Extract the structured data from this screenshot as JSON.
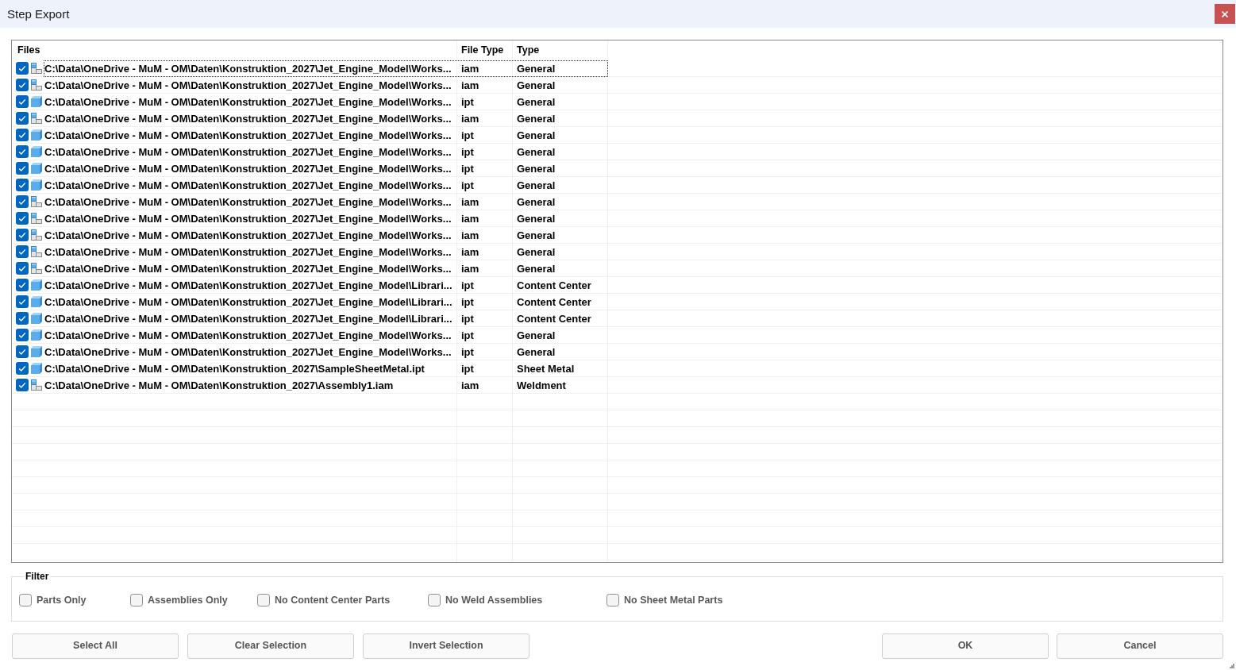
{
  "window": {
    "title": "Step Export"
  },
  "table": {
    "columns": [
      "Files",
      "File Type",
      "Type"
    ],
    "rows": [
      {
        "checked": true,
        "focused": true,
        "kind": "assembly",
        "path": "C:\\Data\\OneDrive - MuM - OM\\Daten\\Konstruktion_2027\\Jet_Engine_Model\\Works...",
        "file_type": "iam",
        "type": "General"
      },
      {
        "checked": true,
        "focused": false,
        "kind": "assembly",
        "path": "C:\\Data\\OneDrive - MuM - OM\\Daten\\Konstruktion_2027\\Jet_Engine_Model\\Works...",
        "file_type": "iam",
        "type": "General"
      },
      {
        "checked": true,
        "focused": false,
        "kind": "part",
        "path": "C:\\Data\\OneDrive - MuM - OM\\Daten\\Konstruktion_2027\\Jet_Engine_Model\\Works...",
        "file_type": "ipt",
        "type": "General"
      },
      {
        "checked": true,
        "focused": false,
        "kind": "assembly",
        "path": "C:\\Data\\OneDrive - MuM - OM\\Daten\\Konstruktion_2027\\Jet_Engine_Model\\Works...",
        "file_type": "iam",
        "type": "General"
      },
      {
        "checked": true,
        "focused": false,
        "kind": "part",
        "path": "C:\\Data\\OneDrive - MuM - OM\\Daten\\Konstruktion_2027\\Jet_Engine_Model\\Works...",
        "file_type": "ipt",
        "type": "General"
      },
      {
        "checked": true,
        "focused": false,
        "kind": "part",
        "path": "C:\\Data\\OneDrive - MuM - OM\\Daten\\Konstruktion_2027\\Jet_Engine_Model\\Works...",
        "file_type": "ipt",
        "type": "General"
      },
      {
        "checked": true,
        "focused": false,
        "kind": "part",
        "path": "C:\\Data\\OneDrive - MuM - OM\\Daten\\Konstruktion_2027\\Jet_Engine_Model\\Works...",
        "file_type": "ipt",
        "type": "General"
      },
      {
        "checked": true,
        "focused": false,
        "kind": "part",
        "path": "C:\\Data\\OneDrive - MuM - OM\\Daten\\Konstruktion_2027\\Jet_Engine_Model\\Works...",
        "file_type": "ipt",
        "type": "General"
      },
      {
        "checked": true,
        "focused": false,
        "kind": "assembly",
        "path": "C:\\Data\\OneDrive - MuM - OM\\Daten\\Konstruktion_2027\\Jet_Engine_Model\\Works...",
        "file_type": "iam",
        "type": "General"
      },
      {
        "checked": true,
        "focused": false,
        "kind": "assembly",
        "path": "C:\\Data\\OneDrive - MuM - OM\\Daten\\Konstruktion_2027\\Jet_Engine_Model\\Works...",
        "file_type": "iam",
        "type": "General"
      },
      {
        "checked": true,
        "focused": false,
        "kind": "assembly",
        "path": "C:\\Data\\OneDrive - MuM - OM\\Daten\\Konstruktion_2027\\Jet_Engine_Model\\Works...",
        "file_type": "iam",
        "type": "General"
      },
      {
        "checked": true,
        "focused": false,
        "kind": "assembly",
        "path": "C:\\Data\\OneDrive - MuM - OM\\Daten\\Konstruktion_2027\\Jet_Engine_Model\\Works...",
        "file_type": "iam",
        "type": "General"
      },
      {
        "checked": true,
        "focused": false,
        "kind": "assembly",
        "path": "C:\\Data\\OneDrive - MuM - OM\\Daten\\Konstruktion_2027\\Jet_Engine_Model\\Works...",
        "file_type": "iam",
        "type": "General"
      },
      {
        "checked": true,
        "focused": false,
        "kind": "part",
        "path": "C:\\Data\\OneDrive - MuM - OM\\Daten\\Konstruktion_2027\\Jet_Engine_Model\\Librari...",
        "file_type": "ipt",
        "type": "Content Center"
      },
      {
        "checked": true,
        "focused": false,
        "kind": "part",
        "path": "C:\\Data\\OneDrive - MuM - OM\\Daten\\Konstruktion_2027\\Jet_Engine_Model\\Librari...",
        "file_type": "ipt",
        "type": "Content Center"
      },
      {
        "checked": true,
        "focused": false,
        "kind": "part",
        "path": "C:\\Data\\OneDrive - MuM - OM\\Daten\\Konstruktion_2027\\Jet_Engine_Model\\Librari...",
        "file_type": "ipt",
        "type": "Content Center"
      },
      {
        "checked": true,
        "focused": false,
        "kind": "part",
        "path": "C:\\Data\\OneDrive - MuM - OM\\Daten\\Konstruktion_2027\\Jet_Engine_Model\\Works...",
        "file_type": "ipt",
        "type": "General"
      },
      {
        "checked": true,
        "focused": false,
        "kind": "part",
        "path": "C:\\Data\\OneDrive - MuM - OM\\Daten\\Konstruktion_2027\\Jet_Engine_Model\\Works...",
        "file_type": "ipt",
        "type": "General"
      },
      {
        "checked": true,
        "focused": false,
        "kind": "part",
        "path": "C:\\Data\\OneDrive - MuM - OM\\Daten\\Konstruktion_2027\\SampleSheetMetal.ipt",
        "file_type": "ipt",
        "type": "Sheet Metal"
      },
      {
        "checked": true,
        "focused": false,
        "kind": "assembly",
        "path": "C:\\Data\\OneDrive - MuM - OM\\Daten\\Konstruktion_2027\\Assembly1.iam",
        "file_type": "iam",
        "type": "Weldment"
      }
    ]
  },
  "filter": {
    "title": "Filter",
    "options": [
      {
        "label": "Parts Only",
        "checked": false
      },
      {
        "label": "Assemblies Only",
        "checked": false
      },
      {
        "label": "No Content Center Parts",
        "checked": false
      },
      {
        "label": "No Weld Assemblies",
        "checked": false
      },
      {
        "label": "No Sheet Metal Parts",
        "checked": false
      }
    ]
  },
  "actions": [
    "Select All",
    "Clear Selection",
    "Invert Selection"
  ],
  "dialog_buttons": [
    "OK",
    "Cancel"
  ]
}
